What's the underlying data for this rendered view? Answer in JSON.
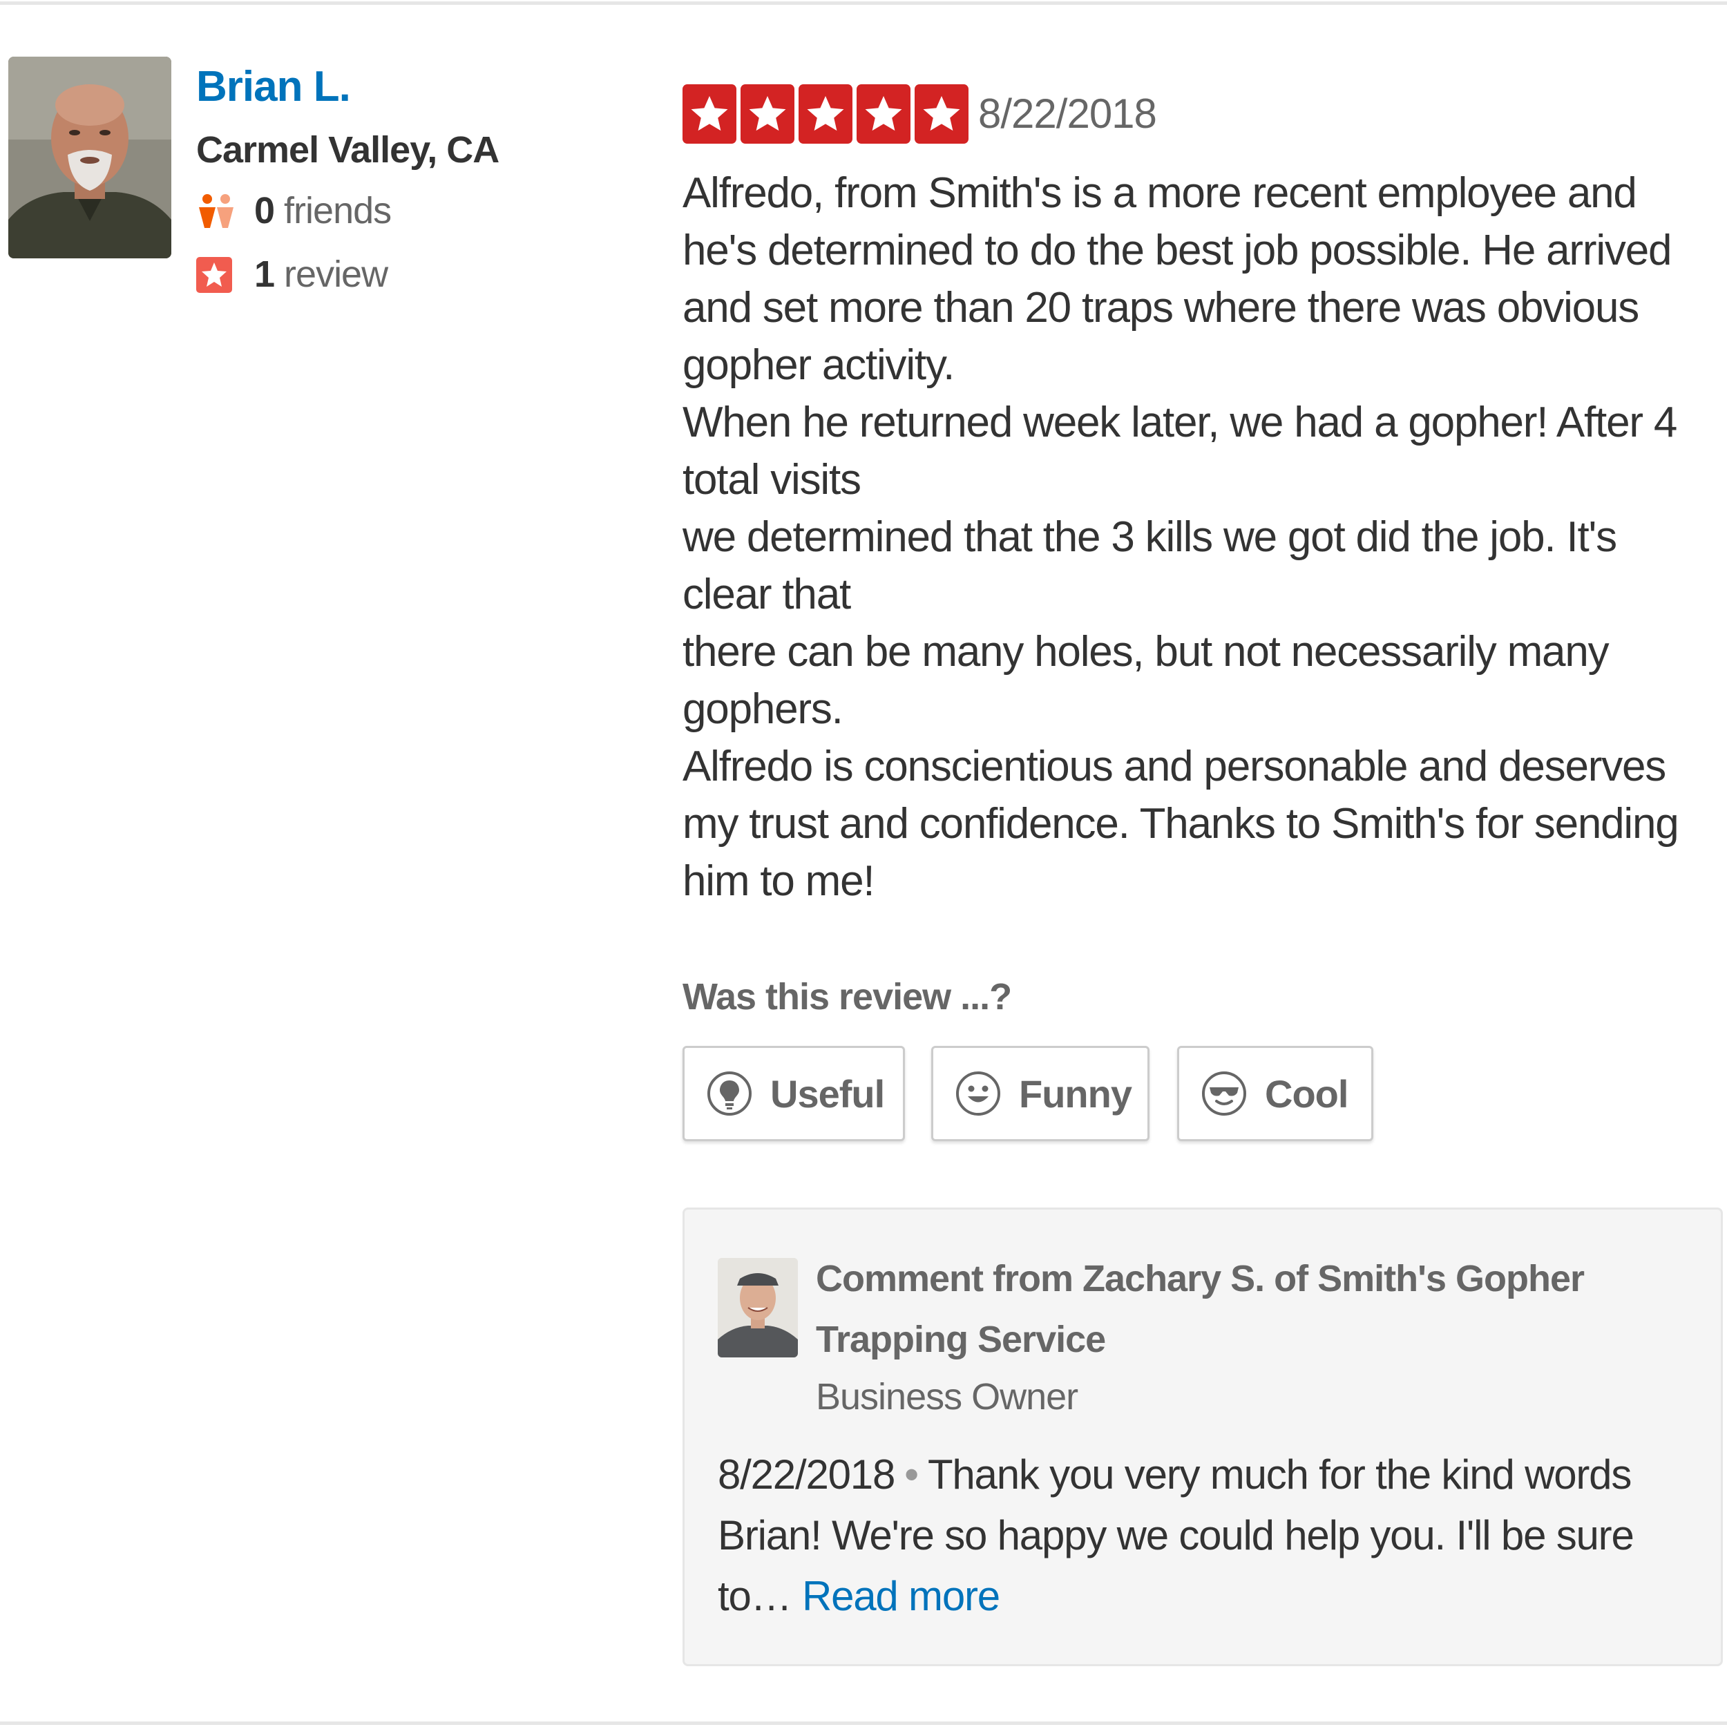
{
  "user": {
    "name": "Brian L.",
    "location": "Carmel Valley, CA",
    "friends_count": "0",
    "friends_label": " friends",
    "reviews_count": "1",
    "reviews_label": " review"
  },
  "review": {
    "rating": 5,
    "date": "8/22/2018",
    "paragraphs": [
      "Alfredo, from Smith's is a more recent employee and he's determined to do the best job possible.  He arrived and set more than 20 traps where there was obvious gopher activity.",
      "When he returned week later, we had a gopher!  After 4 total visits",
      "we determined that the 3 kills we got did the job.  It's clear that",
      "there can be many holes, but not necessarily many gophers.",
      "Alfredo is conscientious and personable and deserves my trust and confidence.  Thanks to Smith's for sending him to me!"
    ]
  },
  "votes": {
    "question": "Was this review ...?",
    "buttons": [
      {
        "label": "Useful",
        "icon": "lightbulb-icon"
      },
      {
        "label": "Funny",
        "icon": "smiley-icon"
      },
      {
        "label": "Cool",
        "icon": "sunglasses-icon"
      }
    ]
  },
  "owner_comment": {
    "title": "Comment from Zachary S. of Smith's Gopher Trapping Service",
    "role": "Business Owner",
    "date": "8/22/2018",
    "separator": "•",
    "text": "Thank you very much for the kind words Brian!  We're so happy we could help you. I'll be sure to…",
    "read_more": "Read more"
  },
  "colors": {
    "star_red": "#d32323",
    "link_blue": "#0073bb",
    "friends_orange": "#f15c00",
    "review_badge_orange": "#f15c4f"
  }
}
